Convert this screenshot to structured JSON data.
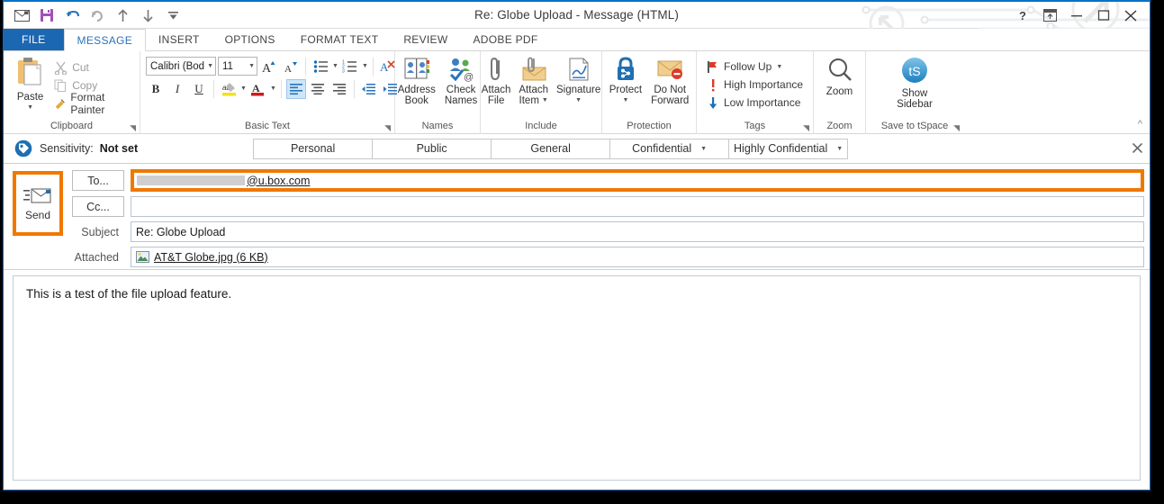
{
  "window": {
    "title": "Re: Globe Upload - Message (HTML)",
    "help_icon": "question-mark-icon",
    "restore_down_icon": "ribbon-display-options-icon",
    "minimize_icon": "minimize-icon",
    "maximize_icon": "maximize-icon",
    "close_icon": "close-icon"
  },
  "quick_access": [
    {
      "name": "new-message-icon",
      "glyph": "envelope"
    },
    {
      "name": "save-icon",
      "glyph": "floppy"
    },
    {
      "name": "undo-icon",
      "glyph": "undo-arrow"
    },
    {
      "name": "redo-icon",
      "glyph": "redo-arrow"
    },
    {
      "name": "previous-item-icon",
      "glyph": "up-arrow"
    },
    {
      "name": "next-item-icon",
      "glyph": "down-arrow"
    },
    {
      "name": "customize-quick-access-toolbar-icon",
      "glyph": "down-caret-bar"
    }
  ],
  "tabs": [
    {
      "label": "FILE",
      "active": false,
      "file": true
    },
    {
      "label": "MESSAGE",
      "active": true,
      "file": false
    },
    {
      "label": "INSERT",
      "active": false,
      "file": false
    },
    {
      "label": "OPTIONS",
      "active": false,
      "file": false
    },
    {
      "label": "FORMAT TEXT",
      "active": false,
      "file": false
    },
    {
      "label": "REVIEW",
      "active": false,
      "file": false
    },
    {
      "label": "ADOBE PDF",
      "active": false,
      "file": false
    }
  ],
  "ribbon": {
    "collapse_icon": "collapse-ribbon-icon",
    "clipboard": {
      "group_label": "Clipboard",
      "paste_label": "Paste",
      "cut_label": "Cut",
      "copy_label": "Copy",
      "format_painter_label": "Format Painter",
      "dialog_launcher": "dialog-box-launcher"
    },
    "basic_text": {
      "group_label": "Basic Text",
      "font_name": "Calibri (Bod",
      "font_size": "11",
      "grow_font_label": "A",
      "shrink_font_label": "A",
      "bold_label": "B",
      "italic_label": "I",
      "underline_label": "U",
      "highlight_label": "ab",
      "font_color_label": "A",
      "dialog_launcher": "dialog-box-launcher"
    },
    "names": {
      "group_label": "Names",
      "address_book_label": "Address\nBook",
      "address_book_line1": "Address",
      "address_book_line2": "Book",
      "check_names_line1": "Check",
      "check_names_line2": "Names"
    },
    "include": {
      "group_label": "Include",
      "attach_file_line1": "Attach",
      "attach_file_line2": "File",
      "attach_item_line1": "Attach",
      "attach_item_line2": "Item",
      "signature_line1": "Signature"
    },
    "protection": {
      "group_label": "Protection",
      "protect_label": "Protect",
      "do_not_forward_line1": "Do Not",
      "do_not_forward_line2": "Forward"
    },
    "tags": {
      "group_label": "Tags",
      "follow_up_label": "Follow Up",
      "high_importance_label": "High Importance",
      "low_importance_label": "Low Importance",
      "dialog_launcher": "dialog-box-launcher"
    },
    "zoom": {
      "group_label": "Zoom",
      "zoom_label": "Zoom"
    },
    "tspace": {
      "group_label": "Save to tSpace",
      "badge_text": "tS",
      "show_sidebar_line1": "Show",
      "show_sidebar_line2": "Sidebar",
      "dialog_launcher": "dialog-box-launcher"
    }
  },
  "sensitivity_bar": {
    "icon": "sensitivity-tag-icon",
    "label": "Sensitivity:",
    "value": "Not set",
    "buttons": [
      {
        "label": "Personal",
        "has_caret": false
      },
      {
        "label": "Public",
        "has_caret": false
      },
      {
        "label": "General",
        "has_caret": false
      },
      {
        "label": "Confidential",
        "has_caret": true
      },
      {
        "label": "Highly Confidential",
        "has_caret": true
      }
    ],
    "close_icon": "close-bar-icon"
  },
  "compose": {
    "send_label": "Send",
    "send_icon": "send-envelope-icon",
    "to_button_label": "To...",
    "cc_button_label": "Cc...",
    "subject_label": "Subject",
    "attached_label": "Attached",
    "to_value_redacted": true,
    "to_value_suffix": "@u.box.com",
    "cc_value": "",
    "subject_value": "Re: Globe Upload",
    "attachment": {
      "icon": "image-file-icon",
      "name": "AT&T Globe.jpg (6 KB)"
    },
    "body_text": "This is a test of the file upload feature."
  },
  "colors": {
    "accent_blue": "#0072c6",
    "file_tab_blue": "#1b67b2",
    "active_tab_text": "#2a72bb",
    "highlight_orange": "#f07800",
    "redaction_grey": "#cfcfcf"
  }
}
